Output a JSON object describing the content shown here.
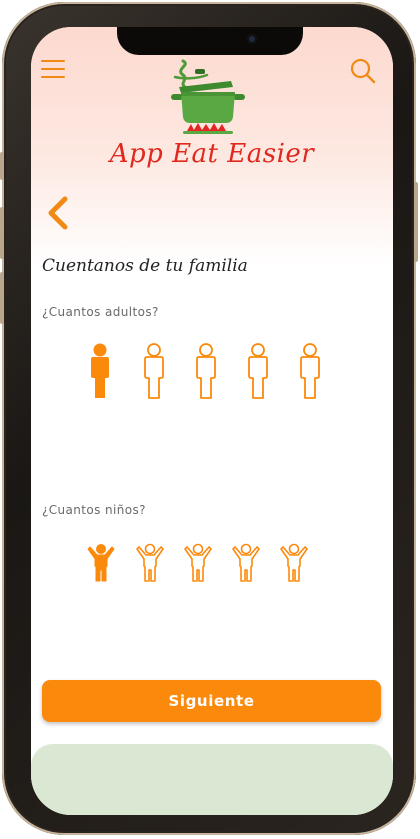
{
  "app": {
    "title": "App Eat Easier"
  },
  "header": {
    "menu_icon": "hamburger-menu-icon",
    "search_icon": "search-icon",
    "logo_icon": "cooking-pot-icon",
    "back_icon": "chevron-left-icon"
  },
  "family": {
    "title": "Cuentanos de tu familia",
    "adults": {
      "label": "¿Cuantos adultos?",
      "selected": 1,
      "options": 5
    },
    "children": {
      "label": "¿Cuantos niños?",
      "selected": 1,
      "options": 5
    }
  },
  "actions": {
    "next_label": "Siguiente"
  },
  "colors": {
    "accent": "#fb8a0c",
    "title_red": "#e0281e",
    "header_pink": "#fdd9cf",
    "panel_green": "#dae7d2"
  }
}
